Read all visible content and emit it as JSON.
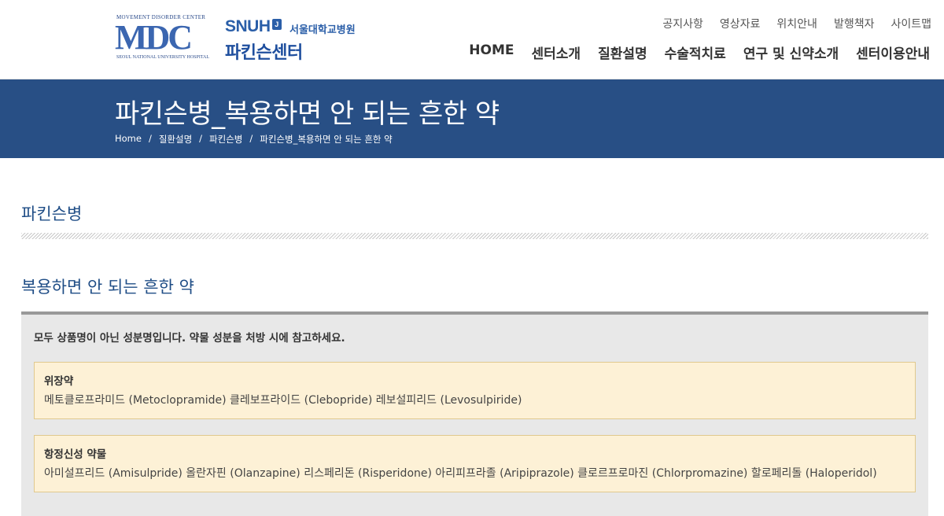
{
  "logo": {
    "mdc_top": "MOVEMENT DISORDER CENTER",
    "mdc_text": "MDC",
    "mdc_bottom": "SEOUL NATIONAL UNIVERSITY HOSPITAL",
    "snuh": "SNUH",
    "snuh_badge": "J",
    "hospital": "서울대학교병원",
    "center": "파킨슨센터"
  },
  "util_nav": [
    "공지사항",
    "영상자료",
    "위치안내",
    "발행책자",
    "사이트맵"
  ],
  "main_nav": [
    "HOME",
    "센터소개",
    "질환설명",
    "수술적치료",
    "연구 및 신약소개",
    "센터이용안내"
  ],
  "banner": {
    "title": "파킨슨병_복용하면 안 되는 흔한 약",
    "breadcrumb": [
      "Home",
      "질환설명",
      "파킨슨병",
      "파킨슨병_복용하면 안 되는 흔한 약"
    ]
  },
  "section1": "파킨슨병",
  "section2": "복용하면 안 되는 흔한 약",
  "note": "모두 상품명이 아닌 성분명입니다. 약물 성분을 처방 시에 참고하세요.",
  "drug_groups": [
    {
      "title": "위장약",
      "drugs": "메토클로프라미드 (Metoclopramide) 클레보프라이드 (Clebopride) 레보설피리드 (Levosulpiride)"
    },
    {
      "title": "항정신성 약물",
      "drugs": "아미설프리드 (Amisulpride) 올란자핀 (Olanzapine) 리스페리돈 (Risperidone) 아리피프라졸 (Aripiprazole) 클로르프로마진 (Chlorpromazine) 할로페리돌 (Haloperidol)"
    }
  ],
  "colors": {
    "banner_bg": "#284f85",
    "heading": "#1f4d86",
    "card_bg": "#fdf1d6",
    "box_bg": "#e8e8e8"
  }
}
